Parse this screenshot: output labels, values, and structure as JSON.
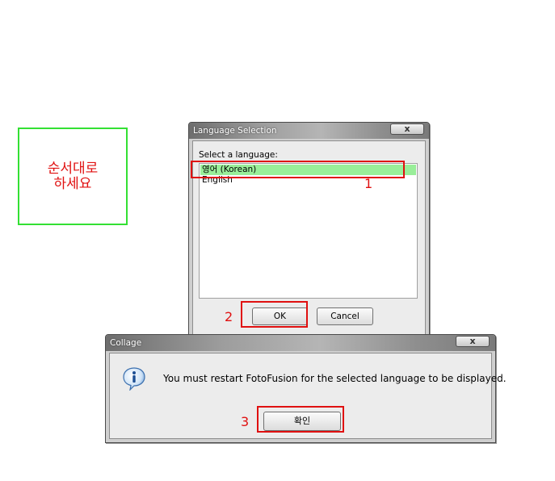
{
  "instruction": {
    "text": "순서대로\n하세요"
  },
  "language_dialog": {
    "title": "Language Selection",
    "close_label": "x",
    "prompt": "Select a language:",
    "languages": [
      "영어 (Korean)",
      "English"
    ],
    "selected_index": 0,
    "ok_label": "OK",
    "cancel_label": "Cancel"
  },
  "collage_dialog": {
    "title": "Collage",
    "close_label": "x",
    "message": "You must restart FotoFusion for the selected language to be displayed.",
    "confirm_label": "확인",
    "icon": "info-icon"
  },
  "annotations": {
    "step1": "1",
    "step2": "2",
    "step3": "3"
  },
  "colors": {
    "highlight": "#99ee99",
    "annotation": "#e01010",
    "frame": "#33e033"
  }
}
